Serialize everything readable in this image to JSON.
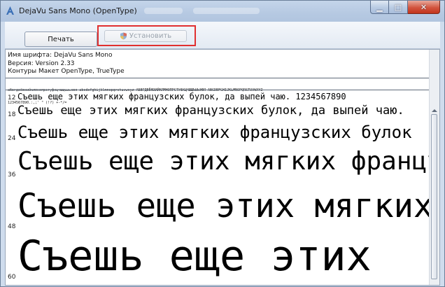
{
  "window": {
    "title": "DejaVu Sans Mono (OpenType)",
    "accent": "#e03030"
  },
  "toolbar": {
    "print_label": "Печать",
    "install_label": "Установить",
    "install_icon": "shield-icon"
  },
  "info": {
    "font_name": "Имя шрифта: DejaVu Sans Mono",
    "version": "Версия: Version 2.33",
    "outlines": "Контуры Макет OpenType, TrueType"
  },
  "charset": {
    "line1": "абвгдеёжзийклмнопрстуфхцчшщъыьэюя abcdefghijklmnopqrstuvwxyz АБВГДЕЁЖЗИЙКЛМНОПРСТУФХЦЧШЩЪЫЬЭЮЯ ABCDEFGHIJKLMNOPQRSTUVWXYZ",
    "line2": "1234567890.:,;' \" (!?) +-*/="
  },
  "samples": [
    {
      "size": "12",
      "text": "Съешь еще этих мягких французских булок, да выпей чаю. 1234567890"
    },
    {
      "size": "18",
      "text": "Съешь еще этих мягких французских булок, да выпей чаю."
    },
    {
      "size": "24",
      "text": "Съешь еще этих мягких французских булок"
    },
    {
      "size": "36",
      "text": "Съешь еще этих мягких французских"
    },
    {
      "size": "48",
      "text": "Съешь еще этих мягких"
    },
    {
      "size": "60",
      "text": "Съешь еще этих"
    }
  ]
}
